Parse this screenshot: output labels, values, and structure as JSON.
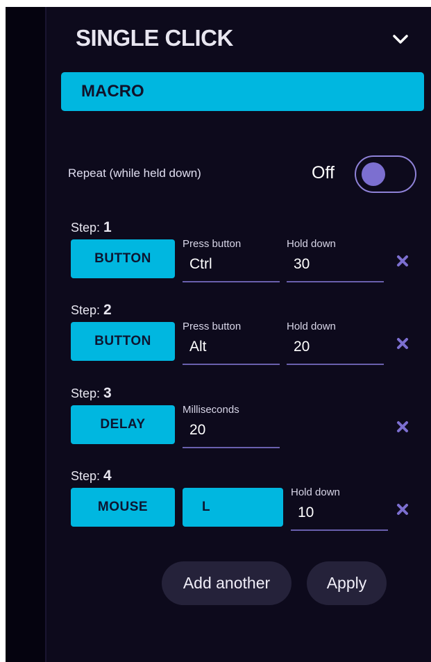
{
  "panel": {
    "title": "SINGLE CLICK",
    "mode": "MACRO"
  },
  "repeat": {
    "label": "Repeat (while held down)",
    "state": "Off"
  },
  "steps": [
    {
      "prefix": "Step:",
      "number": "1",
      "type": "BUTTON",
      "fields": [
        {
          "label": "Press button",
          "value": "Ctrl"
        },
        {
          "label": "Hold down",
          "value": "30"
        }
      ]
    },
    {
      "prefix": "Step:",
      "number": "2",
      "type": "BUTTON",
      "fields": [
        {
          "label": "Press button",
          "value": "Alt"
        },
        {
          "label": "Hold down",
          "value": "20"
        }
      ]
    },
    {
      "prefix": "Step:",
      "number": "3",
      "type": "DELAY",
      "fields": [
        {
          "label": "Milliseconds",
          "value": "20"
        }
      ]
    },
    {
      "prefix": "Step:",
      "number": "4",
      "type": "MOUSE",
      "key": "L",
      "fields": [
        {
          "label": "Hold down",
          "value": "10"
        }
      ]
    }
  ],
  "actions": {
    "add_label": "Add another",
    "apply_label": "Apply"
  },
  "icons": {
    "collapse": "chevron-down-icon",
    "remove": "close-icon"
  },
  "colors": {
    "accent": "#00b7e0",
    "background": "#0d0a1c",
    "toggle": "#7c6fd0",
    "remove": "#7c6fd0"
  }
}
